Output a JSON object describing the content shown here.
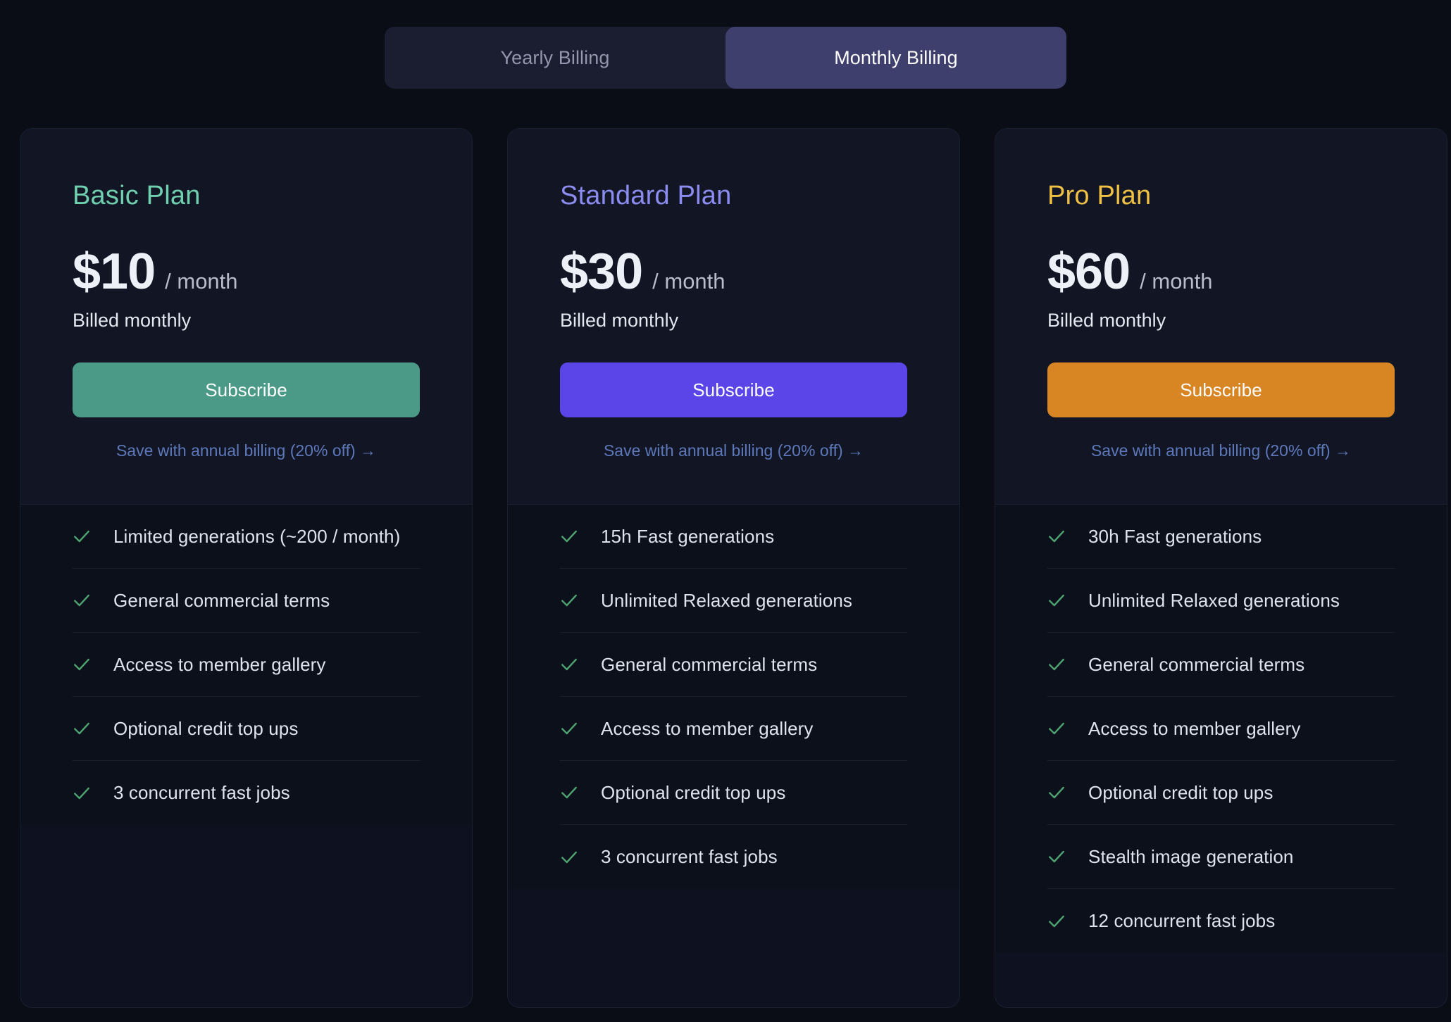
{
  "billing_toggle": {
    "options": [
      {
        "label": "Yearly Billing",
        "active": false
      },
      {
        "label": "Monthly Billing",
        "active": true
      }
    ],
    "selected": "Monthly Billing"
  },
  "colors": {
    "page_background": "#0a0d16",
    "card_background": "#0e1220",
    "toggle_active": "#3f3f6e",
    "basic_accent": "#6fcfae",
    "standard_accent": "#8b8bf0",
    "pro_accent": "#f0c045",
    "basic_button": "#4a9a87",
    "standard_button": "#5b45e8",
    "pro_button": "#d88624",
    "check_green": "#4fa673",
    "save_link": "#5d78ba"
  },
  "plans": [
    {
      "name": "Basic Plan",
      "name_color": "#6fcfae",
      "price": "$10",
      "period": "/ month",
      "billed_note": "Billed monthly",
      "button_label": "Subscribe",
      "button_color": "#4a9a87",
      "save_link": "Save with annual billing (20% off) →",
      "features": [
        "Limited generations (~200 / month)",
        "General commercial terms",
        "Access to member gallery",
        "Optional credit top ups",
        "3 concurrent fast jobs"
      ]
    },
    {
      "name": "Standard Plan",
      "name_color": "#8b8bf0",
      "price": "$30",
      "period": "/ month",
      "billed_note": "Billed monthly",
      "button_label": "Subscribe",
      "button_color": "#5b45e8",
      "save_link": "Save with annual billing (20% off) →",
      "features": [
        "15h Fast generations",
        "Unlimited Relaxed generations",
        "General commercial terms",
        "Access to member gallery",
        "Optional credit top ups",
        "3 concurrent fast jobs"
      ]
    },
    {
      "name": "Pro Plan",
      "name_color": "#f0c045",
      "price": "$60",
      "period": "/ month",
      "billed_note": "Billed monthly",
      "button_label": "Subscribe",
      "button_color": "#d88624",
      "save_link": "Save with annual billing (20% off) →",
      "features": [
        "30h Fast generations",
        "Unlimited Relaxed generations",
        "General commercial terms",
        "Access to member gallery",
        "Optional credit top ups",
        "Stealth image generation",
        "12 concurrent fast jobs"
      ]
    }
  ],
  "icons": {
    "check": "check-icon",
    "arrow_right": "arrow-right-icon"
  }
}
